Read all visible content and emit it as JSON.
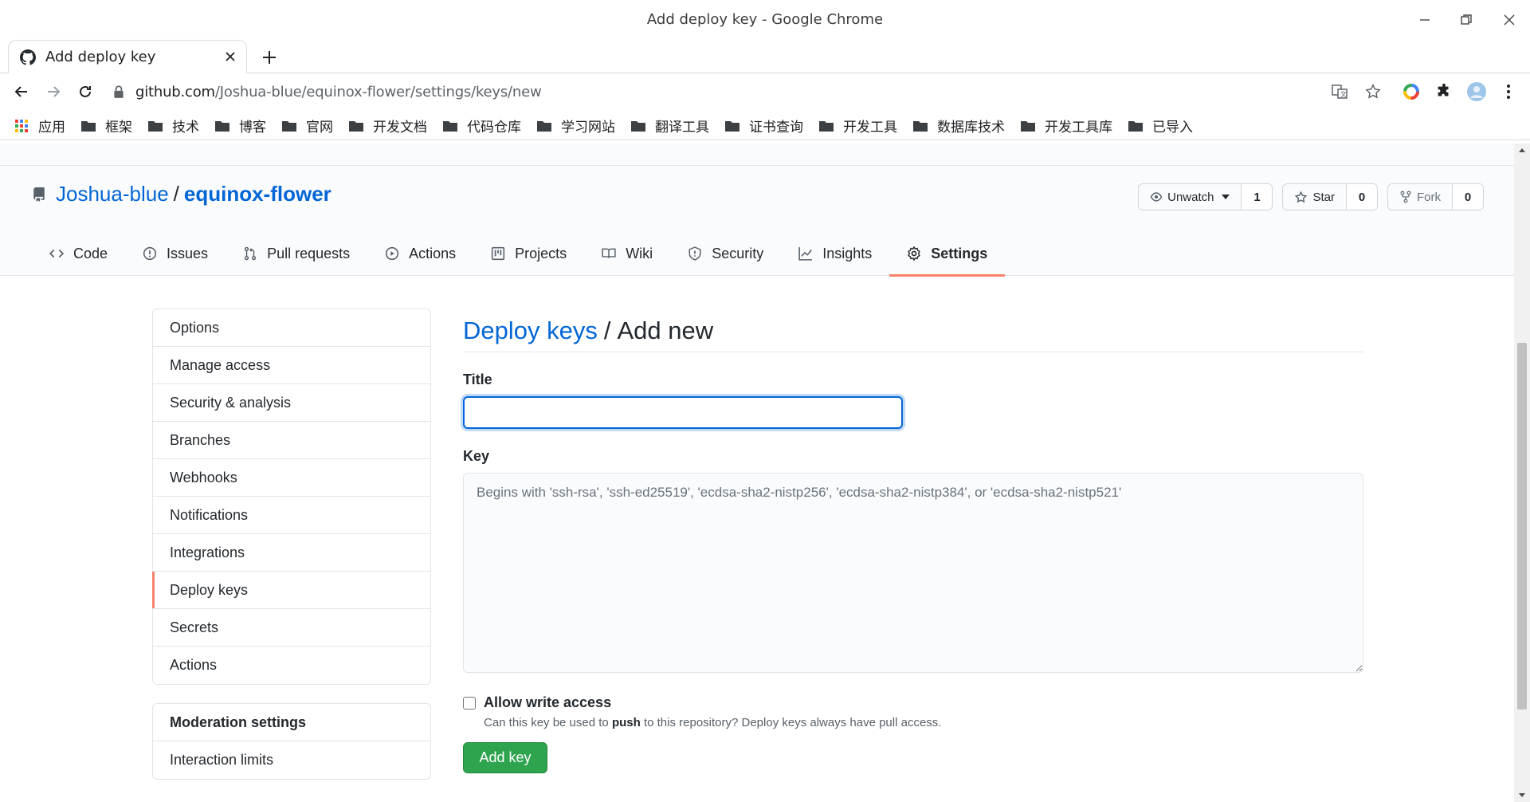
{
  "window": {
    "title": "Add deploy key - Google Chrome"
  },
  "tab": {
    "label": "Add deploy key"
  },
  "address": {
    "host": "github.com",
    "path": "/Joshua-blue/equinox-flower/settings/keys/new"
  },
  "bookmarks": [
    {
      "label": "应用",
      "icon": "apps-grid-icon"
    },
    {
      "label": "框架",
      "icon": "folder-icon"
    },
    {
      "label": "技术",
      "icon": "folder-icon"
    },
    {
      "label": "博客",
      "icon": "folder-icon"
    },
    {
      "label": "官网",
      "icon": "folder-icon"
    },
    {
      "label": "开发文档",
      "icon": "folder-icon"
    },
    {
      "label": "代码仓库",
      "icon": "folder-icon"
    },
    {
      "label": "学习网站",
      "icon": "folder-icon"
    },
    {
      "label": "翻译工具",
      "icon": "folder-icon"
    },
    {
      "label": "证书查询",
      "icon": "folder-icon"
    },
    {
      "label": "开发工具",
      "icon": "folder-icon"
    },
    {
      "label": "数据库技术",
      "icon": "folder-icon"
    },
    {
      "label": "开发工具库",
      "icon": "folder-icon"
    },
    {
      "label": "已导入",
      "icon": "folder-icon"
    }
  ],
  "repo": {
    "owner": "Joshua-blue",
    "separator": "/",
    "name": "equinox-flower",
    "watch_label": "Unwatch",
    "watch_count": "1",
    "star_label": "Star",
    "star_count": "0",
    "fork_label": "Fork",
    "fork_count": "0"
  },
  "nav": {
    "tabs": [
      {
        "label": "Code",
        "icon": "code-icon"
      },
      {
        "label": "Issues",
        "icon": "issue-icon"
      },
      {
        "label": "Pull requests",
        "icon": "pull-request-icon"
      },
      {
        "label": "Actions",
        "icon": "play-icon"
      },
      {
        "label": "Projects",
        "icon": "project-icon"
      },
      {
        "label": "Wiki",
        "icon": "book-icon"
      },
      {
        "label": "Security",
        "icon": "shield-icon"
      },
      {
        "label": "Insights",
        "icon": "graph-icon"
      },
      {
        "label": "Settings",
        "icon": "gear-icon"
      }
    ],
    "selected": "Settings"
  },
  "settings_menu": {
    "items": [
      "Options",
      "Manage access",
      "Security & analysis",
      "Branches",
      "Webhooks",
      "Notifications",
      "Integrations",
      "Deploy keys",
      "Secrets",
      "Actions"
    ],
    "selected": "Deploy keys",
    "moderation_heading": "Moderation settings",
    "moderation_items": [
      "Interaction limits"
    ]
  },
  "form": {
    "breadcrumb_link": "Deploy keys",
    "breadcrumb_sep": "/",
    "heading": "Add new",
    "title_label": "Title",
    "title_value": "",
    "key_label": "Key",
    "key_placeholder": "Begins with 'ssh-rsa', 'ssh-ed25519', 'ecdsa-sha2-nistp256', 'ecdsa-sha2-nistp384', or 'ecdsa-sha2-nistp521'",
    "write_access_label": "Allow write access",
    "write_access_checked": false,
    "write_access_note_pre": "Can this key be used to",
    "write_access_note_bold": "push",
    "write_access_note_post": "to this repository? Deploy keys always have pull access.",
    "submit_label": "Add key"
  },
  "colors": {
    "link": "#0366d6",
    "accent_underline": "#f9826c",
    "primary_button": "#2ea44f"
  }
}
